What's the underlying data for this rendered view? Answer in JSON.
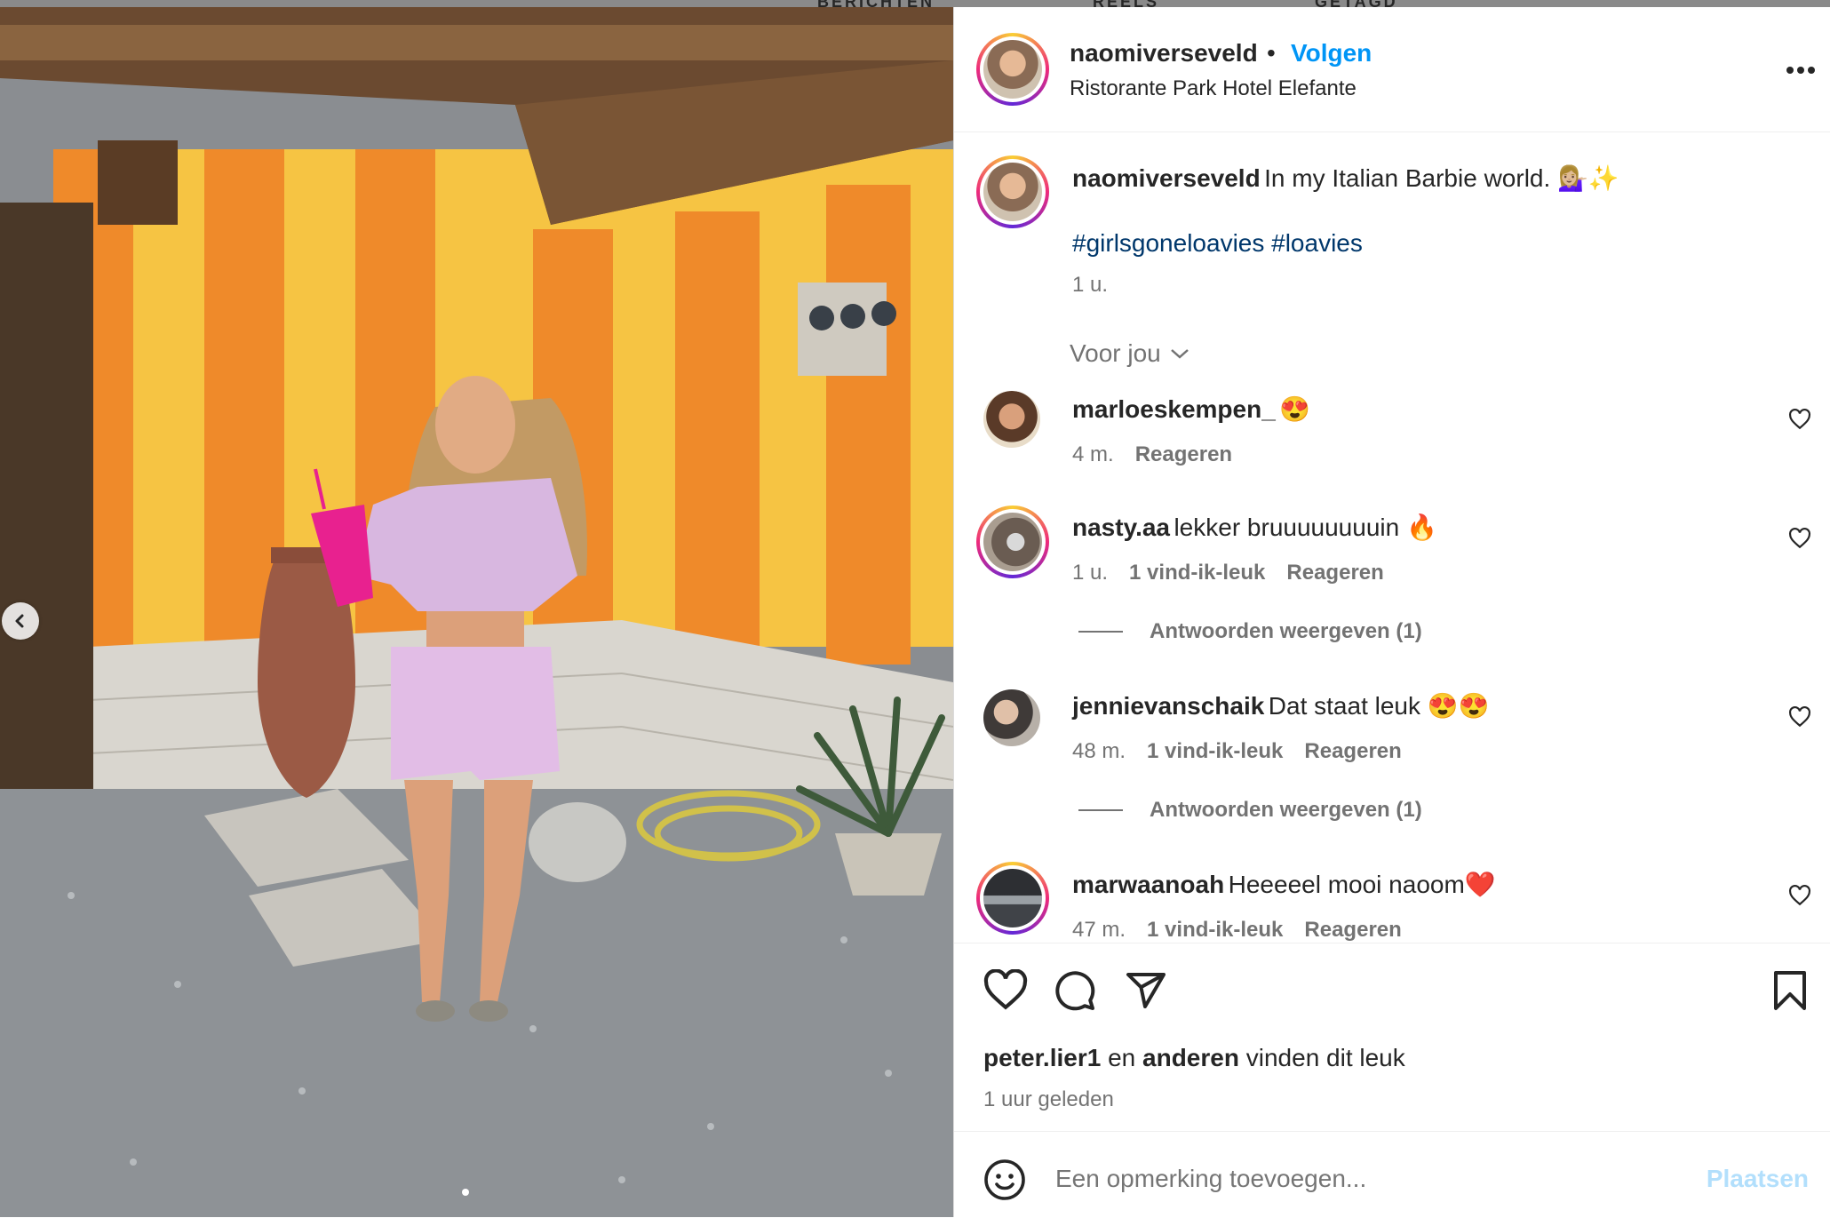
{
  "top_nav": [
    "BERICHTEN",
    "REELS",
    "GETAGD"
  ],
  "post": {
    "username": "naomiverseveld",
    "separator": "•",
    "follow_label": "Volgen",
    "location": "Ristorante Park Hotel Elefante",
    "more_icon": "more-horizontal-icon",
    "caption": {
      "username": "naomiverseveld",
      "text": "In my Italian Barbie world. 💁🏼‍♀️✨",
      "hashtags": "#girlsgoneloavies #loavies",
      "time": "1 u."
    },
    "sort_label": "Voor jou",
    "comments": [
      {
        "username": "marloeskempen_",
        "text": "😍",
        "time": "4 m.",
        "likes": "",
        "reply": "Reageren"
      },
      {
        "username": "nasty.aa",
        "text": "lekker bruuuuuuuuin 🔥",
        "time": "1 u.",
        "likes": "1 vind-ik-leuk",
        "reply": "Reageren",
        "view_replies": "Antwoorden weergeven (1)"
      },
      {
        "username": "jennievanschaik",
        "text": "Dat staat leuk 😍😍",
        "time": "48 m.",
        "likes": "1 vind-ik-leuk",
        "reply": "Reageren",
        "view_replies": "Antwoorden weergeven (1)"
      },
      {
        "username": "marwaanoah",
        "text": "Heeeeel mooi naoom❤️",
        "time": "47 m.",
        "likes": "1 vind-ik-leuk",
        "reply": "Reageren"
      }
    ],
    "likes_line": {
      "user": "peter.lier1",
      "and": "en",
      "others": "anderen",
      "suffix": "vinden dit leuk"
    },
    "posted_ago": "1 uur geleden",
    "comment_input": {
      "placeholder": "Een opmerking toevoegen...",
      "submit": "Plaatsen"
    }
  },
  "colors": {
    "accent": "#0095f6",
    "text": "#262626",
    "muted": "#737373",
    "hashtag": "#00376b",
    "stripe_orange": "#ef8a2a",
    "stripe_yellow": "#f6c443"
  }
}
